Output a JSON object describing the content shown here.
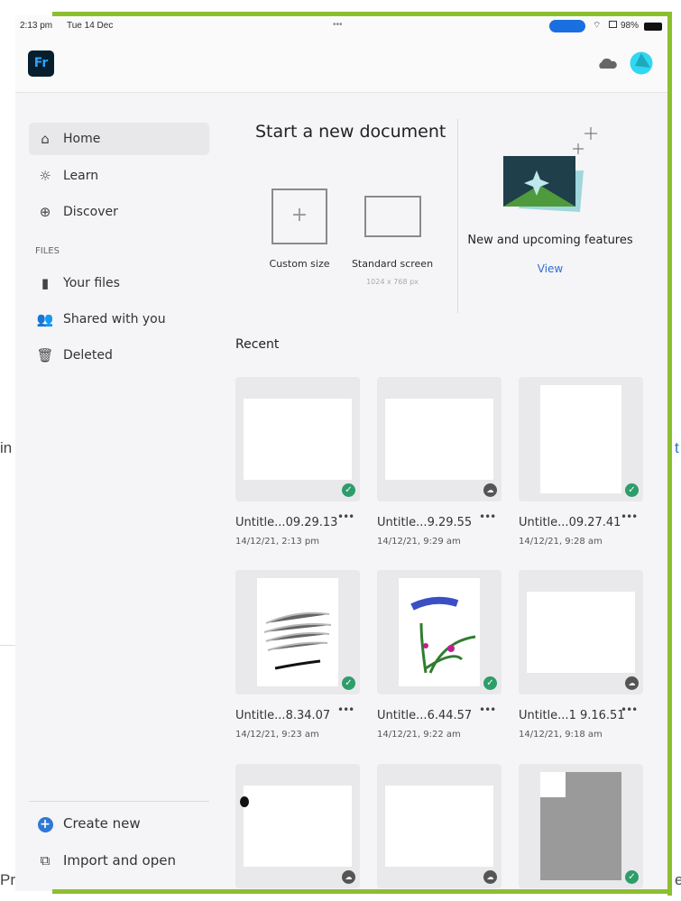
{
  "background_fragments": {
    "left": "in",
    "right": "t",
    "bottom_left": "Priv",
    "bottom_right": "e"
  },
  "status_bar": {
    "time": "2:13 pm",
    "date": "Tue 14 Dec",
    "battery": "98%",
    "dots": "•••"
  },
  "header": {
    "logo": "Fr",
    "cloud_icon": "cloud-icon",
    "avatar": "avatar"
  },
  "sidebar": {
    "items": [
      {
        "label": "Home",
        "icon": "home-icon",
        "active": true
      },
      {
        "label": "Learn",
        "icon": "lightbulb-icon"
      },
      {
        "label": "Discover",
        "icon": "globe-icon"
      }
    ],
    "files_heading": "FILES",
    "file_items": [
      {
        "label": "Your files",
        "icon": "file-icon"
      },
      {
        "label": "Shared with you",
        "icon": "people-icon"
      },
      {
        "label": "Deleted",
        "icon": "trash-icon"
      }
    ],
    "bottom_items": [
      {
        "label": "Create new",
        "icon": "plus-circle-icon"
      },
      {
        "label": "Import and open",
        "icon": "import-icon"
      }
    ]
  },
  "new_document": {
    "title": "Start a new document",
    "custom": {
      "label": "Custom size"
    },
    "standard": {
      "label": "Standard screen",
      "size": "1024 x 768 px"
    }
  },
  "features": {
    "title": "New and upcoming features",
    "link": "View"
  },
  "recent": {
    "heading": "Recent",
    "files": [
      {
        "title": "Untitle...09.29.13",
        "date": "14/12/21, 2:13 pm",
        "status": "synced",
        "thumb": "landscape"
      },
      {
        "title": "Untitle...9.29.55",
        "date": "14/12/21, 9:29 am",
        "status": "cloud",
        "thumb": "landscape"
      },
      {
        "title": "Untitle...09.27.41",
        "date": "14/12/21, 9:28 am",
        "status": "synced",
        "thumb": "portrait"
      },
      {
        "title": "Untitle...8.34.07",
        "date": "14/12/21, 9:23 am",
        "status": "synced",
        "thumb": "sketch"
      },
      {
        "title": "Untitle...6.44.57",
        "date": "14/12/21, 9:22 am",
        "status": "synced",
        "thumb": "flower"
      },
      {
        "title": "Untitle...1 9.16.51",
        "date": "14/12/21, 9:18 am",
        "status": "cloud",
        "thumb": "landscape"
      },
      {
        "status": "cloud",
        "thumb": "landscape-dot"
      },
      {
        "status": "cloud",
        "thumb": "landscape"
      },
      {
        "status": "synced",
        "thumb": "gray-sketch"
      }
    ]
  },
  "colors": {
    "accent": "#8cbf2f",
    "link": "#2f6fd0",
    "synced": "#2d9d6a",
    "logo_bg": "#061e2e",
    "logo_fg": "#2fa3f7"
  }
}
